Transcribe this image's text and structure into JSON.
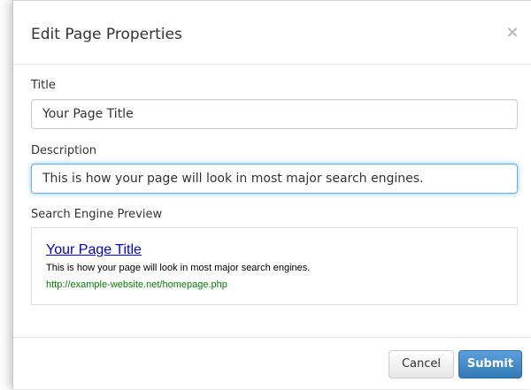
{
  "dialog": {
    "title": "Edit Page Properties",
    "close_glyph": "×"
  },
  "form": {
    "title_label": "Title",
    "title_value": "Your Page Title",
    "description_label": "Description",
    "description_value": "This is how your page will look in most major search engines.",
    "preview_label": "Search Engine Preview"
  },
  "preview": {
    "title": "Your Page Title",
    "description": "This is how your page will look in most major search engines.",
    "url": "http://example-website.net/homepage.php"
  },
  "footer": {
    "cancel_label": "Cancel",
    "submit_label": "Submit"
  },
  "colors": {
    "accent": "#428bca",
    "link": "#0000cc",
    "url_green": "#008000",
    "focus_ring": "#66afe9"
  },
  "icons": {
    "close": "close-icon"
  }
}
